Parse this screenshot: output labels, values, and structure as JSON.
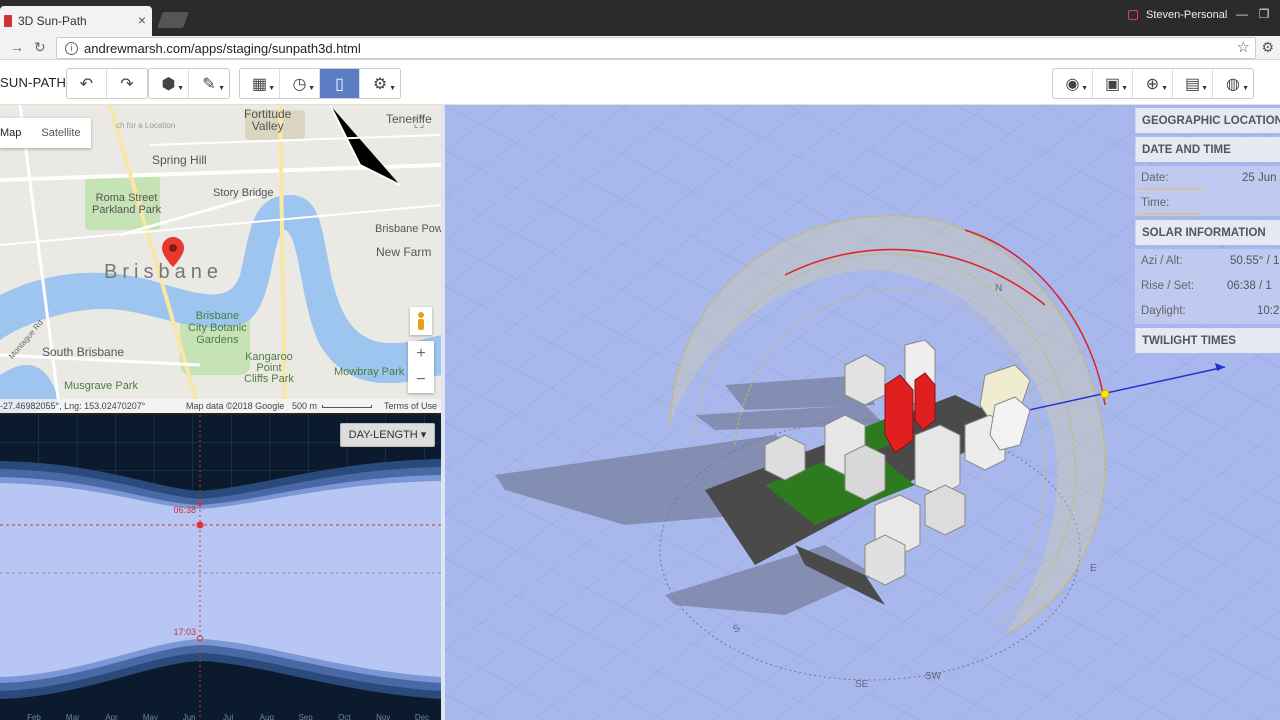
{
  "browser": {
    "tab_title": "3D Sun-Path",
    "tab_close": "×",
    "url": "andrewmarsh.com/apps/staging/sunpath3d.html",
    "profile": "Steven-Personal"
  },
  "toolbar": {
    "app_title": "SUN-PATH:",
    "undo_icon": "undo-icon",
    "redo_icon": "redo-icon",
    "buttons_left": [
      "cube-icon",
      "draw-icon",
      "calendar-icon",
      "clock-icon",
      "panel-icon",
      "gear-icon"
    ],
    "buttons_right": [
      "eye-icon",
      "display-icon",
      "globe-grid-icon",
      "date-icon",
      "globe-icon"
    ]
  },
  "map": {
    "type_map": "Map",
    "type_satellite": "Satellite",
    "labels": {
      "fortitude_valley": "Fortitude\nValley",
      "spring_hill": "Spring Hill",
      "teneriffe": "Teneriffe",
      "roma_street": "Roma Street\nParkland Park",
      "story_bridge": "Story Bridge",
      "brisbane": "Brisbane",
      "brisbane_pow": "Brisbane Pow",
      "new_farm": "New Farm",
      "botanic": "Brisbane\nCity Botanic\nGardens",
      "south_brisbane": "South Brisbane",
      "kangaroo_point": "Kangaroo\nPoint\nCliffs Park",
      "mowbray": "Mowbray Park",
      "musgrave": "Musgrave Park",
      "check_location": "ch for a Location",
      "montague": "Montague Rd"
    },
    "coords": "-27.46982055°, Lng: 153.02470207°",
    "map_data": "Map data ©2018 Google",
    "scale": "500 m",
    "terms": "Terms of Use",
    "zoom_in": "+",
    "zoom_out": "−"
  },
  "chart": {
    "dropdown": "DAY-LENGTH",
    "sunrise_label": "06:38",
    "sunset_label": "17:03",
    "months": [
      "Feb",
      "Mar",
      "Apr",
      "May",
      "Jun",
      "Jul",
      "Aug",
      "Sep",
      "Oct",
      "Nov",
      "Dec"
    ]
  },
  "sidebar": {
    "geographic_location": "GEOGRAPHIC LOCATION",
    "date_and_time": "DATE AND TIME",
    "date_label": "Date:",
    "date_value": "25 Jun",
    "date_slider_fraction": 0.48,
    "time_label": "Time:",
    "time_slider_fraction": 0.45,
    "solar_information": "SOLAR INFORMATION",
    "azi_label": "Azi / Alt:",
    "azi_value": "50.55° / 1",
    "rise_label": "Rise / Set:",
    "rise_value": "06:38 / 1",
    "daylight_label": "Daylight:",
    "daylight_value": "10:2",
    "twilight_times": "TWILIGHT TIMES"
  },
  "view3d": {
    "compass_labels": [
      "S",
      "SE",
      "SW",
      "E",
      "N"
    ],
    "colors": {
      "background": "#a9b8ec",
      "sun_path": "#c8b85a",
      "highlight": "#e02020"
    }
  }
}
